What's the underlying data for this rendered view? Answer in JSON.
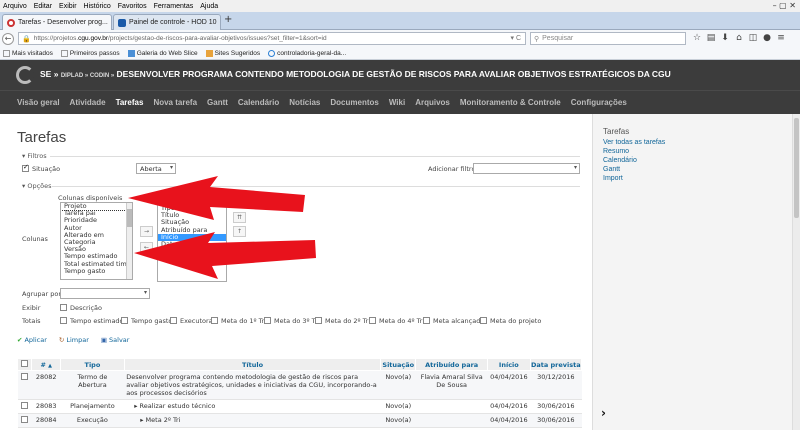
{
  "browser": {
    "menu": [
      "Arquivo",
      "Editar",
      "Exibir",
      "Histórico",
      "Favoritos",
      "Ferramentas",
      "Ajuda"
    ],
    "tabs": [
      {
        "label": "Tarefas - Desenvolver prog...",
        "active": true,
        "close": "×"
      },
      {
        "label": "Painel de controle - HOD 10",
        "active": false,
        "close": "×"
      }
    ],
    "new_tab": "+",
    "window_controls": "–  ▢  ✕",
    "url": {
      "prefix": "https://projetos.",
      "host": "cgu.gov.br",
      "path": "/projects/gestao-de-riscos-para-avaliar-objetivos/issues?set_filter=1&sort=id"
    },
    "url_right": "▾  C",
    "search_placeholder": "Pesquisar",
    "bookmarks": [
      "Mais visitados",
      "Primeiros passos",
      "Galeria do Web Slice",
      "Sites Sugeridos",
      "controladoria-geral-da..."
    ]
  },
  "header": {
    "breadcrumb_a": "SE »",
    "breadcrumb_b": "DIPLAD » CODIN »",
    "project_title": "DESENVOLVER PROGRAMA CONTENDO METODOLOGIA DE GESTÃO DE RISCOS PARA AVALIAR OBJETIVOS ESTRATÉGICOS DA CGU"
  },
  "menu": [
    "Visão geral",
    "Atividade",
    "Tarefas",
    "Nova tarefa",
    "Gantt",
    "Calendário",
    "Notícias",
    "Documentos",
    "Wiki",
    "Arquivos",
    "Monitoramento & Controle",
    "Configurações"
  ],
  "main": {
    "title": "Tarefas",
    "filtros_legend": "▾ Filtros",
    "situacao_label": "Situação",
    "situacao_op": "Aberta",
    "adicionar_filtro": "Adicionar filtro",
    "opcoes_legend": "▾ Opções",
    "colunas_disponiveis": "Colunas disponíveis",
    "colunas_label": "Colunas",
    "available_columns": [
      "Projeto",
      "Tarefa pai",
      "Prioridade",
      "Autor",
      "Alterado em",
      "Categoria",
      "Versão",
      "Tempo estimado",
      "Total estimated time",
      "Tempo gasto"
    ],
    "selected_columns": [
      "Tipo",
      "Título",
      "Situação",
      "Atribuído para",
      "Início",
      "Data"
    ],
    "move_right": "→",
    "move_left": "←",
    "move_top": "⇈",
    "move_up": "↑",
    "agrupar_label": "Agrupar por",
    "exibir_label": "Exibir",
    "descricao": "Descrição",
    "totais_label": "Totais",
    "totals": [
      "Tempo estimado",
      "Tempo gasto",
      "Executora",
      "Meta do 1º Tri",
      "Meta do 3º Tri",
      "Meta do 2º Tri",
      "Meta do 4º Tri",
      "Meta alcançada",
      "Meta do projeto"
    ],
    "aplicar": "Aplicar",
    "limpar": "Limpar",
    "salvar": "Salvar",
    "table": {
      "headers": [
        "#",
        "Tipo",
        "Título",
        "Situação",
        "Atribuído para",
        "Início",
        "Data prevista"
      ],
      "sort_mark": "▲",
      "rows": [
        {
          "id": "28082",
          "tipo": "Termo de Abertura",
          "titulo": "Desenvolver programa contendo metodologia de gestão de riscos para avaliar objetivos estratégicos, unidades e iniciativas da CGU, incorporando-a aos processos decisórios",
          "situacao": "Novo(a)",
          "atribuido": "Flavia Amaral Silva De Sousa",
          "inicio": "04/04/2016",
          "prevista": "30/12/2016"
        },
        {
          "id": "28083",
          "tipo": "Planejamento",
          "titulo": "▸ Realizar estudo técnico",
          "situacao": "Novo(a)",
          "atribuido": "",
          "inicio": "04/04/2016",
          "prevista": "30/06/2016"
        },
        {
          "id": "28084",
          "tipo": "Execução",
          "titulo": "▸ Meta 2º Tri",
          "situacao": "Novo(a)",
          "atribuido": "",
          "inicio": "04/04/2016",
          "prevista": "30/06/2016"
        }
      ]
    }
  },
  "sidebar": {
    "title": "Tarefas",
    "links": [
      "Ver todas as tarefas",
      "Resumo",
      "Calendário",
      "Gantt",
      "Import"
    ],
    "toggle": "›"
  },
  "colors": {
    "header_bg": "#3c3c3c",
    "link": "#116699",
    "arrow": "#e8121c",
    "highlight": "#3399ff"
  }
}
